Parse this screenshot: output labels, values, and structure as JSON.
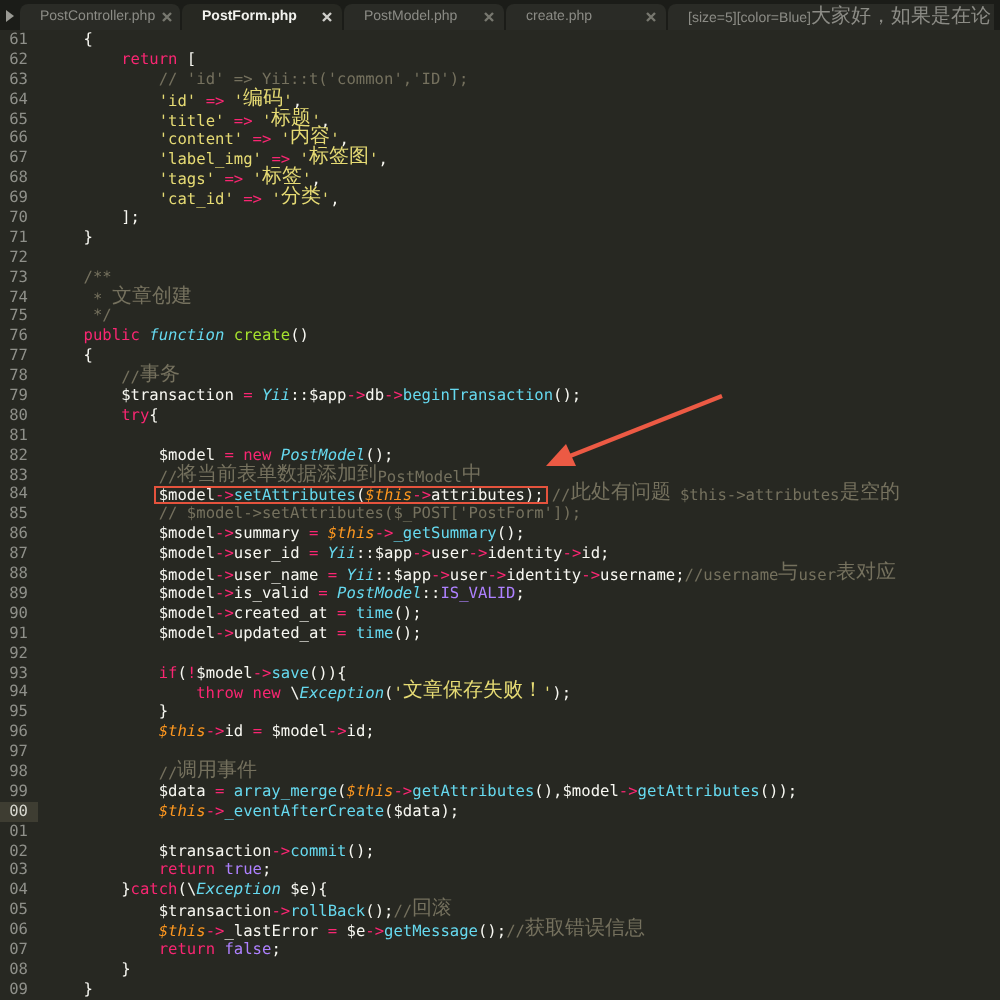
{
  "tabs": [
    {
      "label": "PostController.php",
      "selected": false,
      "closable": true
    },
    {
      "label": "PostForm.php",
      "selected": true,
      "closable": true
    },
    {
      "label": "PostModel.php",
      "selected": false,
      "closable": true
    },
    {
      "label": "create.php",
      "selected": false,
      "closable": true
    },
    {
      "label": "[size=5][color=Blue]大家好，如果是在论",
      "selected": false,
      "closable": false
    }
  ],
  "annotation_arrow": true,
  "lines": [
    {
      "number": "61",
      "current": false,
      "tokens": [
        {
          "kind": "plain",
          "text": "    {"
        }
      ]
    },
    {
      "number": "62",
      "current": false,
      "tokens": [
        {
          "kind": "keyword",
          "text": "        return "
        },
        {
          "kind": "plain",
          "text": "["
        }
      ]
    },
    {
      "number": "63",
      "current": false,
      "tokens": [
        {
          "kind": "comment",
          "text": "            // 'id' => Yii::t('common','ID');"
        }
      ]
    },
    {
      "number": "64",
      "current": false,
      "tokens": [
        {
          "kind": "string",
          "text": "            'id' "
        },
        {
          "kind": "keyword",
          "text": "=> "
        },
        {
          "kind": "string",
          "text": "'编码'"
        },
        {
          "kind": "plain",
          "text": ","
        }
      ]
    },
    {
      "number": "65",
      "current": false,
      "tokens": [
        {
          "kind": "string",
          "text": "            'title' "
        },
        {
          "kind": "keyword",
          "text": "=> "
        },
        {
          "kind": "string",
          "text": "'标题'"
        },
        {
          "kind": "plain",
          "text": ","
        }
      ]
    },
    {
      "number": "66",
      "current": false,
      "tokens": [
        {
          "kind": "string",
          "text": "            'content' "
        },
        {
          "kind": "keyword",
          "text": "=> "
        },
        {
          "kind": "string",
          "text": "'内容'"
        },
        {
          "kind": "plain",
          "text": ","
        }
      ]
    },
    {
      "number": "67",
      "current": false,
      "tokens": [
        {
          "kind": "string",
          "text": "            'label_img' "
        },
        {
          "kind": "keyword",
          "text": "=> "
        },
        {
          "kind": "string",
          "text": "'标签图'"
        },
        {
          "kind": "plain",
          "text": ","
        }
      ]
    },
    {
      "number": "68",
      "current": false,
      "tokens": [
        {
          "kind": "string",
          "text": "            'tags' "
        },
        {
          "kind": "keyword",
          "text": "=> "
        },
        {
          "kind": "string",
          "text": "'标签'"
        },
        {
          "kind": "plain",
          "text": ","
        }
      ]
    },
    {
      "number": "69",
      "current": false,
      "tokens": [
        {
          "kind": "string",
          "text": "            'cat_id' "
        },
        {
          "kind": "keyword",
          "text": "=> "
        },
        {
          "kind": "string",
          "text": "'分类'"
        },
        {
          "kind": "plain",
          "text": ","
        }
      ]
    },
    {
      "number": "70",
      "current": false,
      "tokens": [
        {
          "kind": "plain",
          "text": "        ];"
        }
      ]
    },
    {
      "number": "71",
      "current": false,
      "tokens": [
        {
          "kind": "plain",
          "text": "    }"
        }
      ]
    },
    {
      "number": "72",
      "current": false
    },
    {
      "number": "73",
      "current": false,
      "tokens": [
        {
          "kind": "comment",
          "text": "    /**"
        }
      ]
    },
    {
      "number": "74",
      "current": false,
      "tokens": [
        {
          "kind": "comment",
          "text": "     * 文章创建"
        }
      ]
    },
    {
      "number": "75",
      "current": false,
      "tokens": [
        {
          "kind": "comment",
          "text": "     */"
        }
      ]
    },
    {
      "number": "76",
      "current": false,
      "tokens": [
        {
          "kind": "keyword",
          "text": "    public "
        },
        {
          "kind": "type",
          "text": "function "
        },
        {
          "kind": "def",
          "text": "create"
        },
        {
          "kind": "plain",
          "text": "()"
        }
      ]
    },
    {
      "number": "77",
      "current": false,
      "tokens": [
        {
          "kind": "plain",
          "text": "    {"
        }
      ]
    },
    {
      "number": "78",
      "current": false,
      "tokens": [
        {
          "kind": "comment",
          "text": "        //事务"
        }
      ]
    },
    {
      "number": "79",
      "current": false,
      "tokens": [
        {
          "kind": "plain",
          "text": "        $transaction "
        },
        {
          "kind": "keyword",
          "text": "= "
        },
        {
          "kind": "type",
          "text": "Yii"
        },
        {
          "kind": "plain",
          "text": "::$app"
        },
        {
          "kind": "keyword",
          "text": "->"
        },
        {
          "kind": "plain",
          "text": "db"
        },
        {
          "kind": "keyword",
          "text": "->"
        },
        {
          "kind": "func",
          "text": "beginTransaction"
        },
        {
          "kind": "plain",
          "text": "();"
        }
      ]
    },
    {
      "number": "80",
      "current": false,
      "tokens": [
        {
          "kind": "keyword",
          "text": "        try"
        },
        {
          "kind": "plain",
          "text": "{"
        }
      ]
    },
    {
      "number": "81",
      "current": false
    },
    {
      "number": "82",
      "current": false,
      "tokens": [
        {
          "kind": "plain",
          "text": "            $model "
        },
        {
          "kind": "keyword",
          "text": "= new "
        },
        {
          "kind": "type",
          "text": "PostModel"
        },
        {
          "kind": "plain",
          "text": "();"
        }
      ]
    },
    {
      "number": "83",
      "current": false,
      "tokens": [
        {
          "kind": "comment",
          "text": "            //将当前表单数据添加到PostModel中"
        }
      ]
    },
    {
      "number": "84",
      "current": false,
      "boxed": [
        {
          "kind": "plain",
          "text": "            $model"
        },
        {
          "kind": "keyword",
          "text": "->"
        },
        {
          "kind": "func",
          "text": "setAttributes"
        },
        {
          "kind": "plain",
          "text": "("
        },
        {
          "kind": "var",
          "text": "$this"
        },
        {
          "kind": "keyword",
          "text": "->"
        },
        {
          "kind": "plain",
          "text": "attributes);"
        }
      ],
      "after": [
        {
          "kind": "comment",
          "text": "//此处有问题 $this->attributes是空的"
        }
      ]
    },
    {
      "number": "85",
      "current": false,
      "tokens": [
        {
          "kind": "comment",
          "text": "            // $model->setAttributes($_POST['PostForm']);"
        }
      ]
    },
    {
      "number": "86",
      "current": false,
      "tokens": [
        {
          "kind": "plain",
          "text": "            $model"
        },
        {
          "kind": "keyword",
          "text": "->"
        },
        {
          "kind": "plain",
          "text": "summary "
        },
        {
          "kind": "keyword",
          "text": "= "
        },
        {
          "kind": "var",
          "text": "$this"
        },
        {
          "kind": "keyword",
          "text": "->"
        },
        {
          "kind": "func",
          "text": "_getSummary"
        },
        {
          "kind": "plain",
          "text": "();"
        }
      ]
    },
    {
      "number": "87",
      "current": false,
      "tokens": [
        {
          "kind": "plain",
          "text": "            $model"
        },
        {
          "kind": "keyword",
          "text": "->"
        },
        {
          "kind": "plain",
          "text": "user_id "
        },
        {
          "kind": "keyword",
          "text": "= "
        },
        {
          "kind": "type",
          "text": "Yii"
        },
        {
          "kind": "plain",
          "text": "::$app"
        },
        {
          "kind": "keyword",
          "text": "->"
        },
        {
          "kind": "plain",
          "text": "user"
        },
        {
          "kind": "keyword",
          "text": "->"
        },
        {
          "kind": "plain",
          "text": "identity"
        },
        {
          "kind": "keyword",
          "text": "->"
        },
        {
          "kind": "plain",
          "text": "id;"
        }
      ]
    },
    {
      "number": "88",
      "current": false,
      "tokens": [
        {
          "kind": "plain",
          "text": "            $model"
        },
        {
          "kind": "keyword",
          "text": "->"
        },
        {
          "kind": "plain",
          "text": "user_name "
        },
        {
          "kind": "keyword",
          "text": "= "
        },
        {
          "kind": "type",
          "text": "Yii"
        },
        {
          "kind": "plain",
          "text": "::$app"
        },
        {
          "kind": "keyword",
          "text": "->"
        },
        {
          "kind": "plain",
          "text": "user"
        },
        {
          "kind": "keyword",
          "text": "->"
        },
        {
          "kind": "plain",
          "text": "identity"
        },
        {
          "kind": "keyword",
          "text": "->"
        },
        {
          "kind": "plain",
          "text": "username;"
        },
        {
          "kind": "comment",
          "text": "//username与user表对应"
        }
      ]
    },
    {
      "number": "89",
      "current": false,
      "tokens": [
        {
          "kind": "plain",
          "text": "            $model"
        },
        {
          "kind": "keyword",
          "text": "->"
        },
        {
          "kind": "plain",
          "text": "is_valid "
        },
        {
          "kind": "keyword",
          "text": "= "
        },
        {
          "kind": "type",
          "text": "PostModel"
        },
        {
          "kind": "plain",
          "text": "::"
        },
        {
          "kind": "const",
          "text": "IS_VALID"
        },
        {
          "kind": "plain",
          "text": ";"
        }
      ]
    },
    {
      "number": "90",
      "current": false,
      "tokens": [
        {
          "kind": "plain",
          "text": "            $model"
        },
        {
          "kind": "keyword",
          "text": "->"
        },
        {
          "kind": "plain",
          "text": "created_at "
        },
        {
          "kind": "keyword",
          "text": "= "
        },
        {
          "kind": "func",
          "text": "time"
        },
        {
          "kind": "plain",
          "text": "();"
        }
      ]
    },
    {
      "number": "91",
      "current": false,
      "tokens": [
        {
          "kind": "plain",
          "text": "            $model"
        },
        {
          "kind": "keyword",
          "text": "->"
        },
        {
          "kind": "plain",
          "text": "updated_at "
        },
        {
          "kind": "keyword",
          "text": "= "
        },
        {
          "kind": "func",
          "text": "time"
        },
        {
          "kind": "plain",
          "text": "();"
        }
      ]
    },
    {
      "number": "92",
      "current": false
    },
    {
      "number": "93",
      "current": false,
      "tokens": [
        {
          "kind": "keyword",
          "text": "            if"
        },
        {
          "kind": "plain",
          "text": "("
        },
        {
          "kind": "keyword",
          "text": "!"
        },
        {
          "kind": "plain",
          "text": "$model"
        },
        {
          "kind": "keyword",
          "text": "->"
        },
        {
          "kind": "func",
          "text": "save"
        },
        {
          "kind": "plain",
          "text": "()){"
        }
      ]
    },
    {
      "number": "94",
      "current": false,
      "tokens": [
        {
          "kind": "keyword",
          "text": "                throw new "
        },
        {
          "kind": "plain",
          "text": "\\"
        },
        {
          "kind": "type",
          "text": "Exception"
        },
        {
          "kind": "plain",
          "text": "("
        },
        {
          "kind": "string",
          "text": "'文章保存失败！'"
        },
        {
          "kind": "plain",
          "text": ");"
        }
      ]
    },
    {
      "number": "95",
      "current": false,
      "tokens": [
        {
          "kind": "plain",
          "text": "            }"
        }
      ]
    },
    {
      "number": "96",
      "current": false,
      "tokens": [
        {
          "kind": "var",
          "text": "            $this"
        },
        {
          "kind": "keyword",
          "text": "->"
        },
        {
          "kind": "plain",
          "text": "id "
        },
        {
          "kind": "keyword",
          "text": "= "
        },
        {
          "kind": "plain",
          "text": "$model"
        },
        {
          "kind": "keyword",
          "text": "->"
        },
        {
          "kind": "plain",
          "text": "id;"
        }
      ]
    },
    {
      "number": "97",
      "current": false
    },
    {
      "number": "98",
      "current": false,
      "tokens": [
        {
          "kind": "comment",
          "text": "            //调用事件"
        }
      ]
    },
    {
      "number": "99",
      "current": false,
      "tokens": [
        {
          "kind": "plain",
          "text": "            $data "
        },
        {
          "kind": "keyword",
          "text": "= "
        },
        {
          "kind": "func",
          "text": "array_merge"
        },
        {
          "kind": "plain",
          "text": "("
        },
        {
          "kind": "var",
          "text": "$this"
        },
        {
          "kind": "keyword",
          "text": "->"
        },
        {
          "kind": "func",
          "text": "getAttributes"
        },
        {
          "kind": "plain",
          "text": "(),$model"
        },
        {
          "kind": "keyword",
          "text": "->"
        },
        {
          "kind": "func",
          "text": "getAttributes"
        },
        {
          "kind": "plain",
          "text": "());"
        }
      ]
    },
    {
      "number": "00",
      "current": true,
      "tokens": [
        {
          "kind": "var",
          "text": "            $this"
        },
        {
          "kind": "keyword",
          "text": "->"
        },
        {
          "kind": "func",
          "text": "_eventAfterCreate"
        },
        {
          "kind": "plain",
          "text": "($data);"
        }
      ]
    },
    {
      "number": "01",
      "current": false
    },
    {
      "number": "02",
      "current": false,
      "tokens": [
        {
          "kind": "plain",
          "text": "            $transaction"
        },
        {
          "kind": "keyword",
          "text": "->"
        },
        {
          "kind": "func",
          "text": "commit"
        },
        {
          "kind": "plain",
          "text": "();"
        }
      ]
    },
    {
      "number": "03",
      "current": false,
      "tokens": [
        {
          "kind": "keyword",
          "text": "            return "
        },
        {
          "kind": "const",
          "text": "true"
        },
        {
          "kind": "plain",
          "text": ";"
        }
      ]
    },
    {
      "number": "04",
      "current": false,
      "tokens": [
        {
          "kind": "plain",
          "text": "        }"
        },
        {
          "kind": "keyword",
          "text": "catch"
        },
        {
          "kind": "plain",
          "text": "(\\"
        },
        {
          "kind": "type",
          "text": "Exception"
        },
        {
          "kind": "plain",
          "text": " $e){"
        }
      ]
    },
    {
      "number": "05",
      "current": false,
      "tokens": [
        {
          "kind": "plain",
          "text": "            $transaction"
        },
        {
          "kind": "keyword",
          "text": "->"
        },
        {
          "kind": "func",
          "text": "rollBack"
        },
        {
          "kind": "plain",
          "text": "();"
        },
        {
          "kind": "comment",
          "text": "//回滚"
        }
      ]
    },
    {
      "number": "06",
      "current": false,
      "tokens": [
        {
          "kind": "var",
          "text": "            $this"
        },
        {
          "kind": "keyword",
          "text": "->"
        },
        {
          "kind": "plain",
          "text": "_lastError "
        },
        {
          "kind": "keyword",
          "text": "= "
        },
        {
          "kind": "plain",
          "text": "$e"
        },
        {
          "kind": "keyword",
          "text": "->"
        },
        {
          "kind": "func",
          "text": "getMessage"
        },
        {
          "kind": "plain",
          "text": "();"
        },
        {
          "kind": "comment",
          "text": "//获取错误信息"
        }
      ]
    },
    {
      "number": "07",
      "current": false,
      "tokens": [
        {
          "kind": "keyword",
          "text": "            return "
        },
        {
          "kind": "const",
          "text": "false"
        },
        {
          "kind": "plain",
          "text": ";"
        }
      ]
    },
    {
      "number": "08",
      "current": false,
      "tokens": [
        {
          "kind": "plain",
          "text": "        }"
        }
      ]
    },
    {
      "number": "09",
      "current": false,
      "tokens": [
        {
          "kind": "plain",
          "text": "    }"
        }
      ]
    }
  ]
}
